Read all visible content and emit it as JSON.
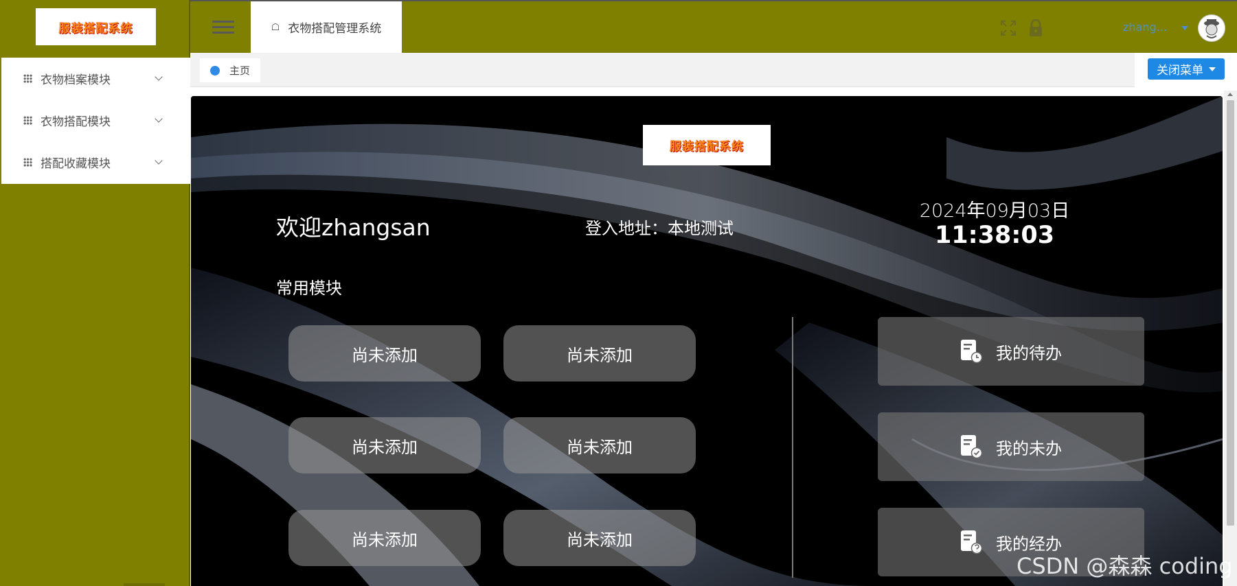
{
  "sidebar": {
    "logo_text": "服装搭配系统",
    "items": [
      {
        "label": "衣物档案模块"
      },
      {
        "label": "衣物搭配模块"
      },
      {
        "label": "搭配收藏模块"
      }
    ]
  },
  "topbar": {
    "tab_label": "衣物搭配管理系统",
    "username": "zhang..."
  },
  "tabbar": {
    "home_tab": "主页",
    "close_menu": "关闭菜单"
  },
  "main": {
    "logo_text": "服装搭配系统",
    "welcome": "欢迎zhangsan",
    "login_address": "登入地址：本地测试",
    "date": "2024年09月03日",
    "time": "11:38:03",
    "common_title": "常用模块",
    "modules": [
      "尚未添加",
      "尚未添加",
      "尚未添加",
      "尚未添加",
      "尚未添加",
      "尚未添加"
    ],
    "tasks": [
      {
        "label": "我的待办",
        "icon": "todo-doc-clock-icon"
      },
      {
        "label": "我的未办",
        "icon": "todo-doc-check-icon"
      },
      {
        "label": "我的经办",
        "icon": "todo-doc-handled-icon"
      }
    ]
  },
  "watermark": "CSDN @森森 coding",
  "colors": {
    "sidebar_bg": "#808000",
    "accent_blue": "#1e88e5",
    "content_bg": "#000000"
  }
}
